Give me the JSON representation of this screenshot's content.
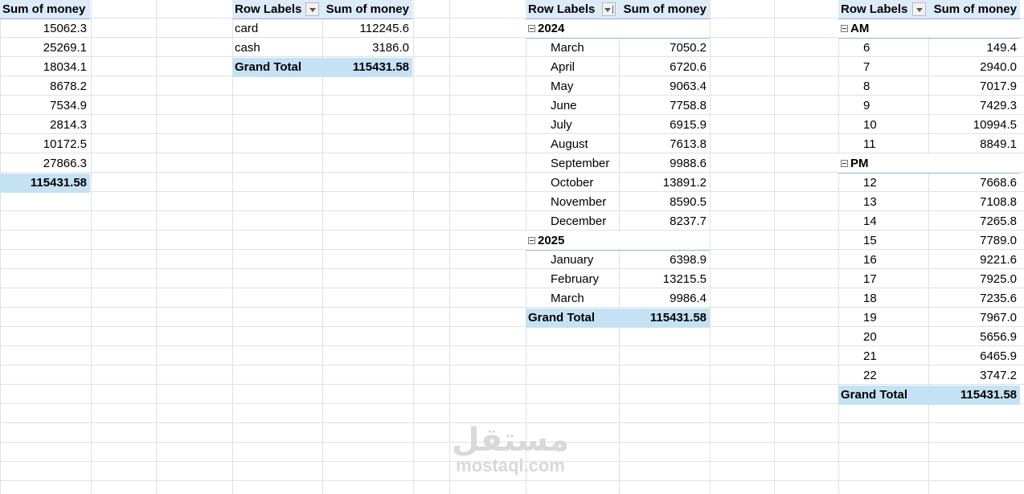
{
  "pivot_values_only": {
    "header": "Sum of money",
    "values": [
      "15062.3",
      "25269.1",
      "18034.1",
      "8678.2",
      "7534.9",
      "2814.3",
      "10172.5",
      "27866.3"
    ],
    "total": "115431.58"
  },
  "pivot_payment": {
    "row_labels": "Row Labels",
    "value_header": "Sum of money",
    "rows": [
      {
        "label": "card",
        "value": "112245.6"
      },
      {
        "label": "cash",
        "value": "3186.0"
      }
    ],
    "grand_total_label": "Grand Total",
    "grand_total": "115431.58"
  },
  "pivot_month": {
    "row_labels": "Row Labels",
    "value_header": "Sum of money",
    "groups": [
      {
        "label": "2024",
        "rows": [
          {
            "label": "March",
            "value": "7050.2"
          },
          {
            "label": "April",
            "value": "6720.6"
          },
          {
            "label": "May",
            "value": "9063.4"
          },
          {
            "label": "June",
            "value": "7758.8"
          },
          {
            "label": "July",
            "value": "6915.9"
          },
          {
            "label": "August",
            "value": "7613.8"
          },
          {
            "label": "September",
            "value": "9988.6"
          },
          {
            "label": "October",
            "value": "13891.2"
          },
          {
            "label": "November",
            "value": "8590.5"
          },
          {
            "label": "December",
            "value": "8237.7"
          }
        ]
      },
      {
        "label": "2025",
        "rows": [
          {
            "label": "January",
            "value": "6398.9"
          },
          {
            "label": "February",
            "value": "13215.5"
          },
          {
            "label": "March",
            "value": "9986.4"
          }
        ]
      }
    ],
    "grand_total_label": "Grand Total",
    "grand_total": "115431.58"
  },
  "pivot_hour": {
    "row_labels": "Row Labels",
    "value_header": "Sum of money",
    "groups": [
      {
        "label": "AM",
        "rows": [
          {
            "label": "6",
            "value": "149.4"
          },
          {
            "label": "7",
            "value": "2940.0"
          },
          {
            "label": "8",
            "value": "7017.9"
          },
          {
            "label": "9",
            "value": "7429.3"
          },
          {
            "label": "10",
            "value": "10994.5"
          },
          {
            "label": "11",
            "value": "8849.1"
          }
        ]
      },
      {
        "label": "PM",
        "rows": [
          {
            "label": "12",
            "value": "7668.6"
          },
          {
            "label": "13",
            "value": "7108.8"
          },
          {
            "label": "14",
            "value": "7265.8"
          },
          {
            "label": "15",
            "value": "7789.0"
          },
          {
            "label": "16",
            "value": "9221.6"
          },
          {
            "label": "17",
            "value": "7925.0"
          },
          {
            "label": "18",
            "value": "7235.6"
          },
          {
            "label": "19",
            "value": "7967.0"
          },
          {
            "label": "20",
            "value": "5656.9"
          },
          {
            "label": "21",
            "value": "6465.9"
          },
          {
            "label": "22",
            "value": "3747.2"
          }
        ]
      }
    ],
    "grand_total_label": "Grand Total",
    "grand_total": "115431.58"
  },
  "watermark": {
    "arabic": "مستقل",
    "latin": "mostaql.com"
  },
  "colors": {
    "header_fill": "#dcebf7",
    "total_fill": "#c5e2f4",
    "gridline": "#e1e1e1",
    "header_rule": "#8db4e2"
  }
}
